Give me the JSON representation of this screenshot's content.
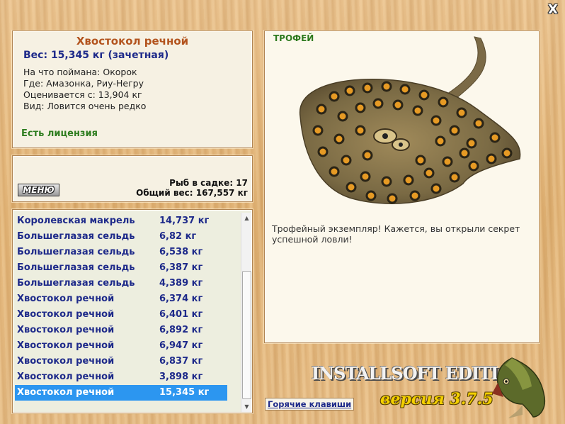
{
  "close_symbol": "X",
  "fish": {
    "title": "Хвостокол речной",
    "weight": "Вес: 15,345 кг (зачетная)",
    "caught_on": "На что поймана: Окорок",
    "location": "Где: Амазонка, Риу-Негру",
    "valued_from": "Оценивается с: 13,904 кг",
    "rarity": "Вид: Ловится очень редко",
    "license": "Есть лицензия"
  },
  "keepnet": {
    "menu_label": "МЕНЮ",
    "fish_count": "Рыб в садке: 17",
    "total_weight": "Общий вес: 167,557 кг"
  },
  "catch_list": [
    {
      "name": "Королевская макрель",
      "weight": "14,737 кг"
    },
    {
      "name": "Большеглазая сельдь",
      "weight": "6,82 кг"
    },
    {
      "name": "Большеглазая сельдь",
      "weight": "6,538 кг"
    },
    {
      "name": "Большеглазая сельдь",
      "weight": "6,387 кг"
    },
    {
      "name": "Большеглазая сельдь",
      "weight": "4,389 кг"
    },
    {
      "name": "Хвостокол речной",
      "weight": "6,374 кг"
    },
    {
      "name": "Хвостокол речной",
      "weight": "6,401 кг"
    },
    {
      "name": "Хвостокол речной",
      "weight": "6,892 кг"
    },
    {
      "name": "Хвостокол речной",
      "weight": "6,947 кг"
    },
    {
      "name": "Хвостокол речной",
      "weight": "6,837 кг"
    },
    {
      "name": "Хвостокол речной",
      "weight": "3,898 кг"
    },
    {
      "name": "Хвостокол речной",
      "weight": "15,345 кг"
    }
  ],
  "selected_index": 11,
  "trophy": {
    "label": "ТРОФЕЙ",
    "message": "Трофейный экземпляр! Кажется, вы открыли секрет успешной ловли!"
  },
  "hotkeys_label": "Горячие клавиши",
  "edition": {
    "name": "INSTALLSOFT EDITION",
    "version": "версия 3.7.5"
  },
  "icons": {
    "close": "close-icon",
    "scroll_up": "chevron-up-icon",
    "scroll_down": "chevron-down-icon",
    "trophy_image": "stingray-image",
    "logo": "pike-fish-logo"
  },
  "colors": {
    "title": "#b3541e",
    "accent_blue": "#1e2a8a",
    "license_green": "#2e7d1f",
    "selection": "#2c96f0",
    "version_yellow": "#f4d000"
  }
}
